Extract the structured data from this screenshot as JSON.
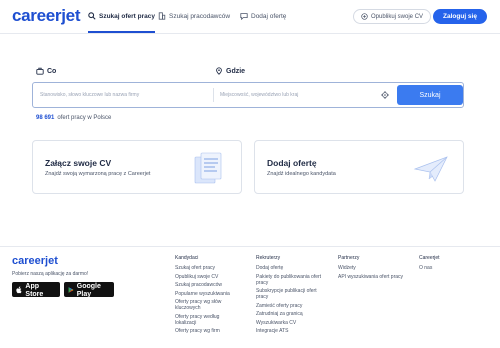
{
  "header": {
    "logo": "careerjet",
    "nav": [
      {
        "label": "Szukaj ofert pracy",
        "icon": "search-icon",
        "active": true
      },
      {
        "label": "Szukaj pracodawców",
        "icon": "building-icon",
        "active": false
      },
      {
        "label": "Dodaj ofertę",
        "icon": "chat-icon",
        "active": false
      }
    ],
    "post_cv": "Opublikuj swoje CV",
    "login": "Zaloguj się"
  },
  "search": {
    "what_label": "Co",
    "where_label": "Gdzie",
    "what_placeholder": "Stanowisko, słowo kluczowe lub nazwa firmy",
    "where_placeholder": "Miejscowość, województwo lub kraj",
    "button": "Szukaj",
    "job_count_number": "98 691",
    "job_count_text": "ofert pracy w Polsce"
  },
  "cards": [
    {
      "title": "Załącz swoje CV",
      "subtitle": "Znajdź swoją wymarzoną pracę z Careerjet"
    },
    {
      "title": "Dodaj ofertę",
      "subtitle": "Znajdź idealnego kandydata"
    }
  ],
  "footer": {
    "logo": "careerjet",
    "app_text": "Pobierz naszą aplikację za darmo!",
    "app_store": {
      "small": "Pobierz z",
      "big": "App Store"
    },
    "google_play": {
      "small": "POBIERZ Z",
      "big": "Google Play"
    },
    "columns": [
      {
        "title": "Kandydaci",
        "links": [
          "Szukaj ofert pracy",
          "Opublikuj swoje CV",
          "Szukaj pracodawców",
          "Popularne wyszukiwania",
          "Oferty pracy wg słów kluczowych",
          "Oferty pracy według lokalizacji",
          "Oferty pracy wg firm"
        ]
      },
      {
        "title": "Rekruterzy",
        "links": [
          "Dodaj ofertę",
          "Pakiety do publikowania ofert pracy",
          "Subskrypcje publikacji ofert pracy",
          "Zamieść oferty pracy",
          "Zatrudniaj za granicą",
          "Wyszukiwarka CV",
          "Integracje ATS"
        ]
      },
      {
        "title": "Partnerzy",
        "links": [
          "Widżety",
          "API wyszukiwania ofert pracy"
        ]
      },
      {
        "title": "Careerjet",
        "links": [
          "O nas"
        ]
      }
    ]
  },
  "colors": {
    "brand": "#1e4fd1",
    "button": "#3b7bf0",
    "login": "#2563eb"
  }
}
